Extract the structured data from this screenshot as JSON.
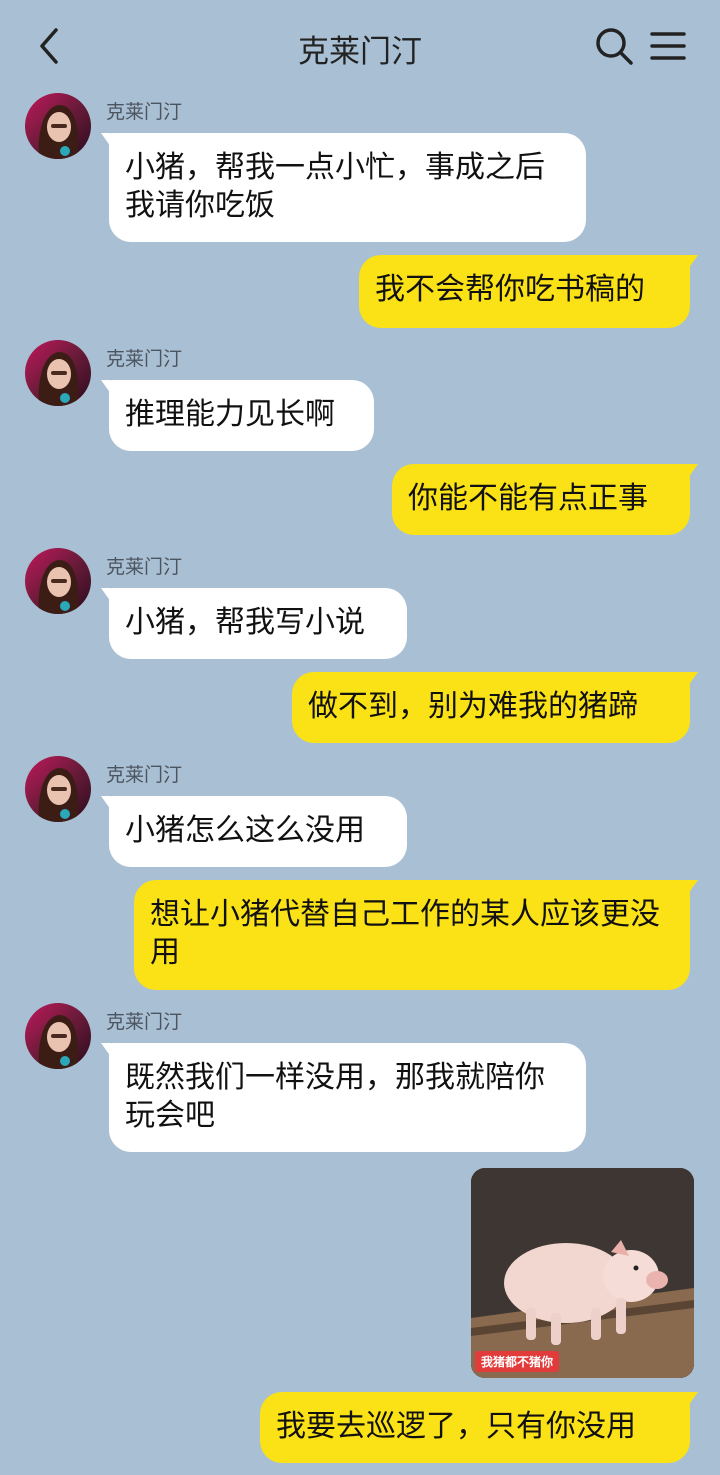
{
  "header": {
    "title": "克莱门汀",
    "back_icon": "chevron-left-icon",
    "search_icon": "search-icon",
    "menu_icon": "menu-icon"
  },
  "contact": {
    "name": "克莱门汀"
  },
  "messages": [
    {
      "from": "contact",
      "text": "小猪，帮我一点小忙，事成之后我请你吃饭"
    },
    {
      "from": "me",
      "text": "我不会帮你吃书稿的"
    },
    {
      "from": "contact",
      "text": "推理能力见长啊"
    },
    {
      "from": "me",
      "text": "你能不能有点正事"
    },
    {
      "from": "contact",
      "text": "小猪，帮我写小说"
    },
    {
      "from": "me",
      "text": "做不到，别为难我的猪蹄"
    },
    {
      "from": "contact",
      "text": "小猪怎么这么没用"
    },
    {
      "from": "me",
      "text": "想让小猪代替自己工作的某人应该更没用"
    },
    {
      "from": "contact",
      "text": "既然我们一样没用，那我就陪你玩会吧"
    },
    {
      "from": "me",
      "type": "sticker",
      "caption": "我猪都不猪你"
    },
    {
      "from": "me",
      "text": "我要去巡逻了，只有你没用"
    }
  ],
  "colors": {
    "background": "#a9bfd3",
    "incoming_bubble": "#ffffff",
    "outgoing_bubble": "#fbe216"
  }
}
